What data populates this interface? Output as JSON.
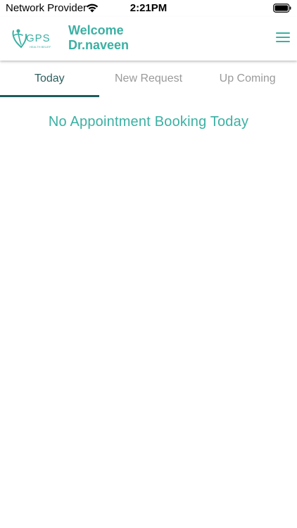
{
  "status_bar": {
    "carrier": "Network Provider",
    "time": "2:21PM",
    "wifi_icon": "wifi-icon",
    "battery_icon": "battery-icon"
  },
  "header": {
    "logo": {
      "icon": "gps-logo-icon",
      "text": "GPS",
      "tagline": "HEALTH BELIEF"
    },
    "welcome_line1": "Welcome",
    "welcome_line2": "Dr.naveen",
    "menu_icon": "hamburger-menu-icon"
  },
  "tabs": [
    {
      "label": "Today",
      "active": true
    },
    {
      "label": "New Request",
      "active": false
    },
    {
      "label": "Up Coming",
      "active": false
    }
  ],
  "content": {
    "empty_message": "No Appointment Booking Today"
  },
  "colors": {
    "accent": "#3bb0a3",
    "tab_active_text": "#2f5e5e",
    "tab_indicator": "#1f5c5c",
    "tab_inactive_text": "#9a9a9a"
  }
}
